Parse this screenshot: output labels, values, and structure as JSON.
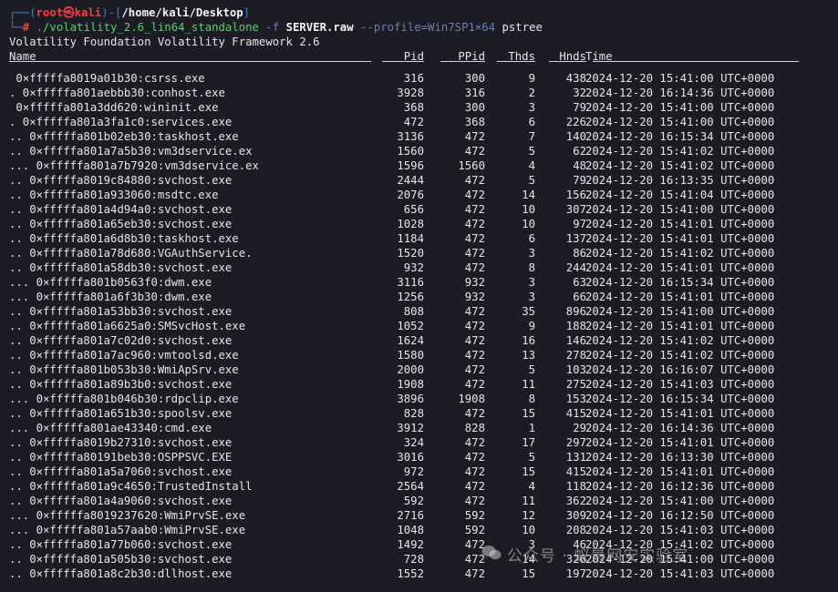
{
  "prompt": {
    "corner_top": "┌──(",
    "user": "root",
    "at": "㉿",
    "host": "kali",
    "close": ")-[",
    "path": "/home/kali/Desktop",
    "end": "]",
    "corner_bottom": "└─",
    "hash": "#",
    "command_prog": "./volatility_2.6_lin64_standalone",
    "command_f": "-f",
    "command_file": "SERVER.raw",
    "command_profile": "--profile=Win7SP1×64",
    "command_plugin": "pstree"
  },
  "banner": "Volatility Foundation Volatility Framework 2.6",
  "headers": {
    "name": "Name",
    "pid": "Pid",
    "ppid": "PPid",
    "thds": "Thds",
    "hnds": "Hnds",
    "time": "Time"
  },
  "rows": [
    {
      "name": " 0×fffffa8019a01b30:csrss.exe",
      "pid": "316",
      "ppid": "300",
      "thds": "9",
      "hnds": "438",
      "time": "2024-12-20 15:41:00 UTC+0000"
    },
    {
      "name": ". 0×fffffa801aebbb30:conhost.exe",
      "pid": "3928",
      "ppid": "316",
      "thds": "2",
      "hnds": "32",
      "time": "2024-12-20 16:14:36 UTC+0000"
    },
    {
      "name": " 0×fffffa801a3dd620:wininit.exe",
      "pid": "368",
      "ppid": "300",
      "thds": "3",
      "hnds": "79",
      "time": "2024-12-20 15:41:00 UTC+0000"
    },
    {
      "name": ". 0×fffffa801a3fa1c0:services.exe",
      "pid": "472",
      "ppid": "368",
      "thds": "6",
      "hnds": "226",
      "time": "2024-12-20 15:41:00 UTC+0000"
    },
    {
      "name": ".. 0×fffffa801b02eb30:taskhost.exe",
      "pid": "3136",
      "ppid": "472",
      "thds": "7",
      "hnds": "140",
      "time": "2024-12-20 16:15:34 UTC+0000"
    },
    {
      "name": ".. 0×fffffa801a7a5b30:vm3dservice.ex",
      "pid": "1560",
      "ppid": "472",
      "thds": "5",
      "hnds": "62",
      "time": "2024-12-20 15:41:02 UTC+0000"
    },
    {
      "name": "... 0×fffffa801a7b7920:vm3dservice.ex",
      "pid": "1596",
      "ppid": "1560",
      "thds": "4",
      "hnds": "48",
      "time": "2024-12-20 15:41:02 UTC+0000"
    },
    {
      "name": ".. 0×fffffa8019c84880:svchost.exe",
      "pid": "2444",
      "ppid": "472",
      "thds": "5",
      "hnds": "79",
      "time": "2024-12-20 16:13:35 UTC+0000"
    },
    {
      "name": ".. 0×fffffa801a933060:msdtc.exe",
      "pid": "2076",
      "ppid": "472",
      "thds": "14",
      "hnds": "156",
      "time": "2024-12-20 15:41:04 UTC+0000"
    },
    {
      "name": ".. 0×fffffa801a4d94a0:svchost.exe",
      "pid": "656",
      "ppid": "472",
      "thds": "10",
      "hnds": "307",
      "time": "2024-12-20 15:41:00 UTC+0000"
    },
    {
      "name": ".. 0×fffffa801a65eb30:svchost.exe",
      "pid": "1028",
      "ppid": "472",
      "thds": "10",
      "hnds": "97",
      "time": "2024-12-20 15:41:01 UTC+0000"
    },
    {
      "name": ".. 0×fffffa801a6d8b30:taskhost.exe",
      "pid": "1184",
      "ppid": "472",
      "thds": "6",
      "hnds": "137",
      "time": "2024-12-20 15:41:01 UTC+0000"
    },
    {
      "name": ".. 0×fffffa801a78d680:VGAuthService.",
      "pid": "1520",
      "ppid": "472",
      "thds": "3",
      "hnds": "86",
      "time": "2024-12-20 15:41:02 UTC+0000"
    },
    {
      "name": ".. 0×fffffa801a58db30:svchost.exe",
      "pid": "932",
      "ppid": "472",
      "thds": "8",
      "hnds": "244",
      "time": "2024-12-20 15:41:01 UTC+0000"
    },
    {
      "name": "... 0×fffffa801b0563f0:dwm.exe",
      "pid": "3116",
      "ppid": "932",
      "thds": "3",
      "hnds": "63",
      "time": "2024-12-20 16:15:34 UTC+0000"
    },
    {
      "name": "... 0×fffffa801a6f3b30:dwm.exe",
      "pid": "1256",
      "ppid": "932",
      "thds": "3",
      "hnds": "66",
      "time": "2024-12-20 15:41:01 UTC+0000"
    },
    {
      "name": ".. 0×fffffa801a53bb30:svchost.exe",
      "pid": "808",
      "ppid": "472",
      "thds": "35",
      "hnds": "896",
      "time": "2024-12-20 15:41:00 UTC+0000"
    },
    {
      "name": ".. 0×fffffa801a6625a0:SMSvcHost.exe",
      "pid": "1052",
      "ppid": "472",
      "thds": "9",
      "hnds": "188",
      "time": "2024-12-20 15:41:01 UTC+0000"
    },
    {
      "name": ".. 0×fffffa801a7c02d0:svchost.exe",
      "pid": "1624",
      "ppid": "472",
      "thds": "16",
      "hnds": "146",
      "time": "2024-12-20 15:41:02 UTC+0000"
    },
    {
      "name": ".. 0×fffffa801a7ac960:vmtoolsd.exe",
      "pid": "1580",
      "ppid": "472",
      "thds": "13",
      "hnds": "278",
      "time": "2024-12-20 15:41:02 UTC+0000"
    },
    {
      "name": ".. 0×fffffa801b053b30:WmiApSrv.exe",
      "pid": "2000",
      "ppid": "472",
      "thds": "5",
      "hnds": "103",
      "time": "2024-12-20 16:16:07 UTC+0000"
    },
    {
      "name": ".. 0×fffffa801a89b3b0:svchost.exe",
      "pid": "1908",
      "ppid": "472",
      "thds": "11",
      "hnds": "275",
      "time": "2024-12-20 15:41:03 UTC+0000"
    },
    {
      "name": "... 0×fffffa801b046b30:rdpclip.exe",
      "pid": "3896",
      "ppid": "1908",
      "thds": "8",
      "hnds": "153",
      "time": "2024-12-20 16:15:34 UTC+0000"
    },
    {
      "name": ".. 0×fffffa801a651b30:spoolsv.exe",
      "pid": "828",
      "ppid": "472",
      "thds": "15",
      "hnds": "415",
      "time": "2024-12-20 15:41:01 UTC+0000"
    },
    {
      "name": "... 0×fffffa801ae43340:cmd.exe",
      "pid": "3912",
      "ppid": "828",
      "thds": "1",
      "hnds": "29",
      "time": "2024-12-20 16:14:36 UTC+0000"
    },
    {
      "name": ".. 0×fffffa8019b27310:svchost.exe",
      "pid": "324",
      "ppid": "472",
      "thds": "17",
      "hnds": "297",
      "time": "2024-12-20 15:41:01 UTC+0000"
    },
    {
      "name": ".. 0×fffffa80191beb30:OSPPSVC.EXE",
      "pid": "3016",
      "ppid": "472",
      "thds": "5",
      "hnds": "131",
      "time": "2024-12-20 16:13:30 UTC+0000"
    },
    {
      "name": ".. 0×fffffa801a5a7060:svchost.exe",
      "pid": "972",
      "ppid": "472",
      "thds": "15",
      "hnds": "415",
      "time": "2024-12-20 15:41:01 UTC+0000"
    },
    {
      "name": ".. 0×fffffa801a9c4650:TrustedInstall",
      "pid": "2564",
      "ppid": "472",
      "thds": "4",
      "hnds": "118",
      "time": "2024-12-20 16:12:36 UTC+0000"
    },
    {
      "name": ".. 0×fffffa801a4a9060:svchost.exe",
      "pid": "592",
      "ppid": "472",
      "thds": "11",
      "hnds": "362",
      "time": "2024-12-20 15:41:00 UTC+0000"
    },
    {
      "name": "... 0×fffffa8019237620:WmiPrvSE.exe",
      "pid": "2716",
      "ppid": "592",
      "thds": "12",
      "hnds": "309",
      "time": "2024-12-20 16:12:50 UTC+0000"
    },
    {
      "name": "... 0×fffffa801a57aab0:WmiPrvSE.exe",
      "pid": "1048",
      "ppid": "592",
      "thds": "10",
      "hnds": "208",
      "time": "2024-12-20 15:41:03 UTC+0000"
    },
    {
      "name": ".. 0×fffffa801a77b060:svchost.exe",
      "pid": "1492",
      "ppid": "472",
      "thds": "3",
      "hnds": "46",
      "time": "2024-12-20 15:41:02 UTC+0000"
    },
    {
      "name": ".. 0×fffffa801a505b30:svchost.exe",
      "pid": "728",
      "ppid": "472",
      "thds": "14",
      "hnds": "326",
      "time": "2024-12-20 15:41:00 UTC+0000"
    },
    {
      "name": ".. 0×fffffa801a8c2b30:dllhost.exe",
      "pid": "1552",
      "ppid": "472",
      "thds": "15",
      "hnds": "197",
      "time": "2024-12-20 15:41:03 UTC+0000"
    }
  ],
  "watermark": "公众号 · 蚁景网安实验室",
  "colors": {
    "background": "#1b1c24",
    "prompt_blue": "#3a7bd5",
    "prompt_red": "#ff3b3b",
    "command_green": "#52d46b",
    "flag_blue": "#6e7dbb"
  }
}
